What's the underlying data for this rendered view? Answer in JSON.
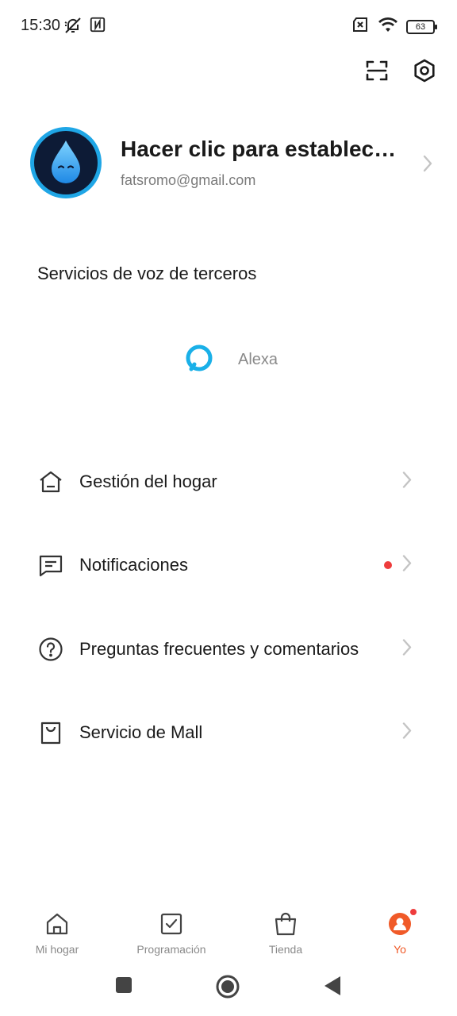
{
  "status_bar": {
    "time": "15:30",
    "battery": "63",
    "icons": [
      "mute-bell-icon",
      "nfc-icon",
      "sim-off-icon",
      "wifi-icon",
      "battery-icon"
    ]
  },
  "top_actions": {
    "icons": [
      "scan-icon",
      "settings-icon"
    ]
  },
  "profile": {
    "name": "Hacer clic para establecer el nombre",
    "email": "fatsromo@gmail.com"
  },
  "voice_services": {
    "title": "Servicios de voz de terceros",
    "items": [
      {
        "label": "Alexa",
        "icon": "alexa-icon"
      }
    ]
  },
  "menu": {
    "items": [
      {
        "label": "Gestión del hogar",
        "icon": "home-manage-icon"
      },
      {
        "label": "Notificaciones",
        "icon": "message-icon",
        "has_dot": true
      },
      {
        "label": "Preguntas frecuentes y comentarios",
        "icon": "help-icon"
      },
      {
        "label": "Servicio de Mall",
        "icon": "bag-icon"
      }
    ]
  },
  "tab_bar": {
    "tabs": [
      {
        "label": "Mi hogar",
        "icon": "home-icon",
        "active": false
      },
      {
        "label": "Programación",
        "icon": "checkbox-icon",
        "active": false
      },
      {
        "label": "Tienda",
        "icon": "shopping-bag-icon",
        "active": false
      },
      {
        "label": "Yo",
        "icon": "user-icon",
        "active": true
      }
    ]
  },
  "colors": {
    "accent": "#f05a28",
    "notification_dot": "#ee3c3c",
    "alexa": "#1ab0e8",
    "avatar_ring": "#1fa6e6"
  }
}
